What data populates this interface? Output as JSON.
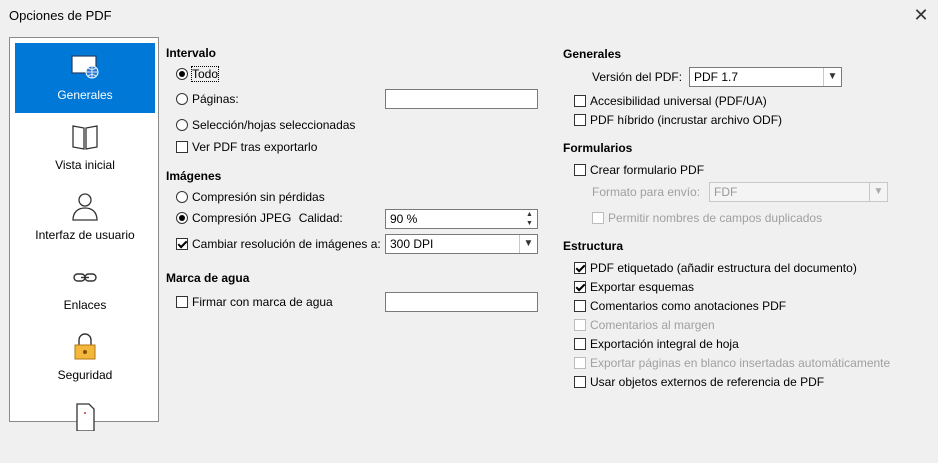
{
  "window": {
    "title": "Opciones de PDF",
    "close_glyph": "✕"
  },
  "sidebar": {
    "items": [
      {
        "label": "Generales",
        "icon": "general-icon",
        "selected": true
      },
      {
        "label": "Vista inicial",
        "icon": "initial-view-icon"
      },
      {
        "label": "Interfaz de usuario",
        "icon": "user-interface-icon"
      },
      {
        "label": "Enlaces",
        "icon": "links-icon"
      },
      {
        "label": "Seguridad",
        "icon": "security-icon"
      },
      {
        "label": "",
        "icon": "signature-icon"
      }
    ]
  },
  "left": {
    "interval": {
      "heading": "Intervalo",
      "all": "Todo",
      "pages": "Páginas:",
      "pages_value": "",
      "selection": "Selección/hojas seleccionadas",
      "view_after": "Ver PDF tras exportarlo"
    },
    "images": {
      "heading": "Imágenes",
      "lossless": "Compresión sin pérdidas",
      "jpeg": "Compresión JPEG",
      "quality_label": "Calidad:",
      "quality_value": "90 %",
      "reduce_res": "Cambiar resolución de imágenes a:",
      "dpi_value": "300 DPI"
    },
    "watermark": {
      "heading": "Marca de agua",
      "sign": "Firmar con marca de agua",
      "value": ""
    }
  },
  "right": {
    "general": {
      "heading": "Generales",
      "version_label": "Versión del PDF:",
      "version_value": "PDF 1.7",
      "ua": "Accesibilidad universal (PDF/UA)",
      "hybrid": "PDF híbrido (incrustar archivo ODF)"
    },
    "forms": {
      "heading": "Formularios",
      "create": "Crear formulario PDF",
      "format_label": "Formato para envío:",
      "format_value": "FDF",
      "duplicates": "Permitir nombres de campos duplicados"
    },
    "structure": {
      "heading": "Estructura",
      "tagged": "PDF etiquetado (añadir estructura del documento)",
      "outlines": "Exportar esquemas",
      "comments": "Comentarios como anotaciones PDF",
      "margin_comments": "Comentarios al margen",
      "full_sheet": "Exportación integral de hoja",
      "blank_pages": "Exportar páginas en blanco insertadas automáticamente",
      "external_refs": "Usar objetos externos de referencia de PDF"
    }
  },
  "colors": {
    "accent": "#0078d7"
  }
}
